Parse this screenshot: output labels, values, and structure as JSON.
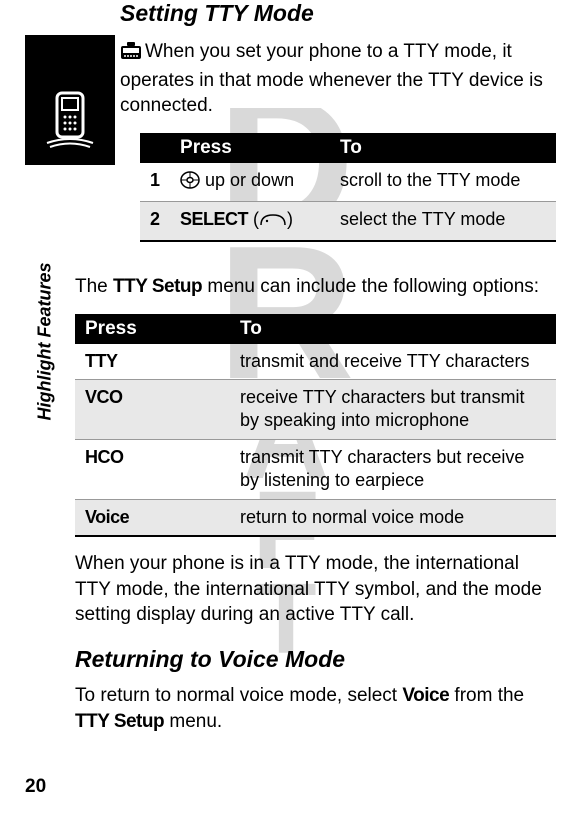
{
  "watermark": "DRAFT",
  "sidebar": {
    "label": "Highlight Features"
  },
  "heading1": "Setting TTY Mode",
  "intro": "When you set your phone to a TTY mode, it operates in that mode whenever the TTY device is connected.",
  "table1": {
    "headers": {
      "press": "Press",
      "to": "To"
    },
    "rows": [
      {
        "num": "1",
        "press_suffix": " up or down",
        "to": "scroll to the TTY mode"
      },
      {
        "num": "2",
        "press_label": "SELECT",
        "press_paren_open": " (",
        "press_paren_close": ")",
        "to": "select the TTY mode"
      }
    ]
  },
  "mid_text_a": "The ",
  "mid_text_menu": "TTY Setup",
  "mid_text_b": " menu can include the following options:",
  "table2": {
    "headers": {
      "press": "Press",
      "to": "To"
    },
    "rows": [
      {
        "press": "TTY",
        "to": "transmit and receive TTY characters"
      },
      {
        "press": "VCO",
        "to": "receive TTY characters but transmit by speaking into microphone"
      },
      {
        "press": "HCO",
        "to": "transmit TTY characters but receive by listening to earpiece"
      },
      {
        "press": "Voice",
        "to": "return to normal voice mode"
      }
    ]
  },
  "after_text": "When your phone is in a TTY mode, the international TTY mode, the international TTY symbol, and the mode setting display during an active TTY call.",
  "heading2": "Returning to Voice Mode",
  "return_text_a": "To return to normal voice mode, select ",
  "return_voice": "Voice",
  "return_text_b": " from the ",
  "return_menu": "TTY Setup",
  "return_text_c": " menu.",
  "page_num": "20"
}
